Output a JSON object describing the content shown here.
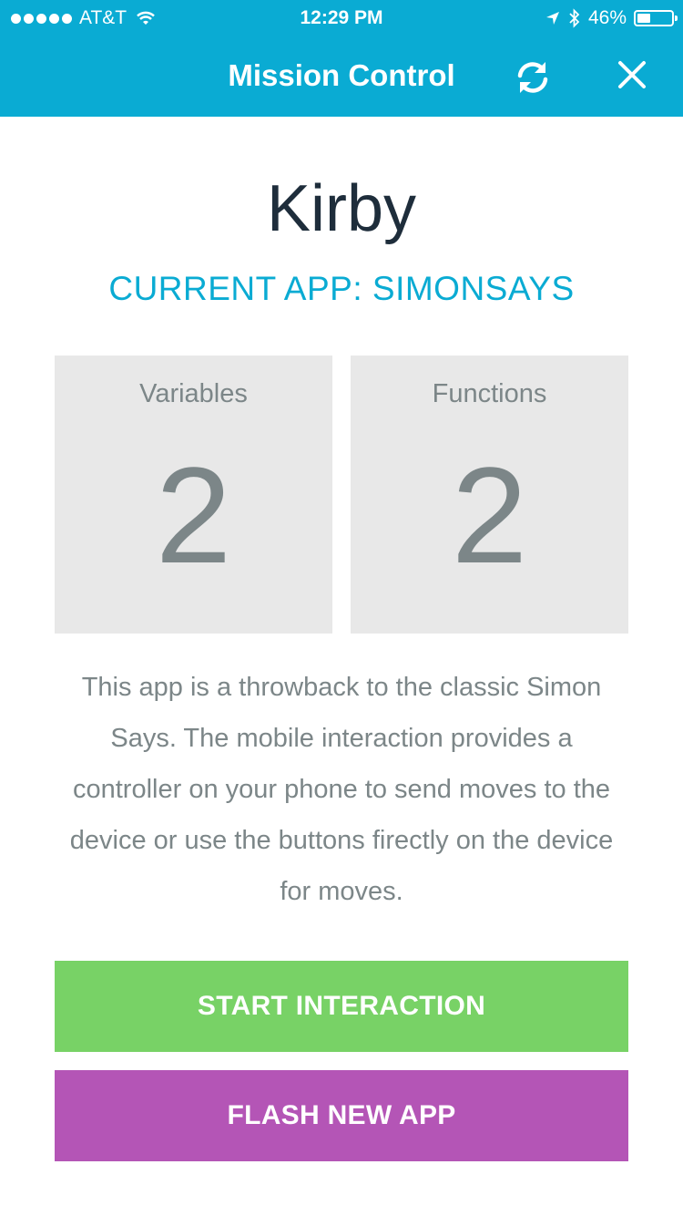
{
  "status_bar": {
    "carrier": "AT&T",
    "time": "12:29 PM",
    "battery_percent": "46%",
    "battery_level": 0.46
  },
  "nav": {
    "title": "Mission Control",
    "refresh_icon": "refresh-icon",
    "close_icon": "close-icon"
  },
  "device": {
    "name": "Kirby",
    "current_app": "CURRENT APP: SIMONSAYS"
  },
  "stats": {
    "variables_label": "Variables",
    "variables_count": "2",
    "functions_label": "Functions",
    "functions_count": "2"
  },
  "description": "This app is a throwback to the classic Simon Says. The mobile interaction provides a controller on your phone to send moves to the device or use the buttons firectly on the device for moves.",
  "actions": {
    "start_label": "START INTERACTION",
    "flash_label": "FLASH NEW APP"
  },
  "colors": {
    "header": "#0aabd3",
    "accent_text": "#0aabd3",
    "start_button": "#78d266",
    "flash_button": "#b455b6",
    "stat_box": "#e8e8e8"
  }
}
